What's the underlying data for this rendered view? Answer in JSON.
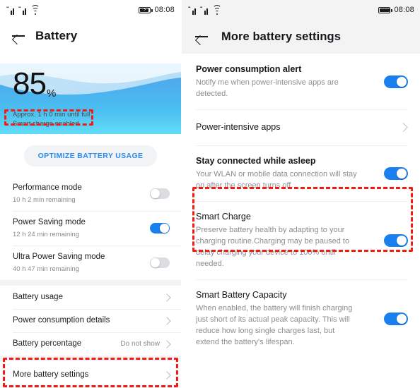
{
  "left_screen": {
    "status_bar": {
      "time": "08:08",
      "signal_icon": "signal-bars-icon",
      "signal_icon_2": "signal-bars-icon",
      "wifi_icon": "wifi-icon",
      "battery_icon": "battery-charging-icon",
      "battery_level_pct": 62
    },
    "app_bar": {
      "back_icon": "back-arrow-icon",
      "title": "Battery"
    },
    "hero": {
      "percent": "85",
      "percent_symbol": "%",
      "time_remaining": "Approx. 1 h 0 min until full",
      "smart_charge_status": "Smart charge enabled"
    },
    "optimize_button": "OPTIMIZE BATTERY USAGE",
    "modes": [
      {
        "title": "Performance mode",
        "subtitle": "10 h 2 min remaining",
        "toggle": "off"
      },
      {
        "title": "Power Saving mode",
        "subtitle": "12 h 24 min remaining",
        "toggle": "on"
      },
      {
        "title": "Ultra Power Saving mode",
        "subtitle": "40 h 47 min remaining",
        "toggle": "off"
      }
    ],
    "links": [
      {
        "title": "Battery usage",
        "value": "",
        "chevron": "chevron-right-icon"
      },
      {
        "title": "Power consumption details",
        "value": "",
        "chevron": "chevron-right-icon"
      },
      {
        "title": "Battery percentage",
        "value": "Do not show",
        "chevron": "chevron-right-icon"
      }
    ],
    "more_settings": {
      "title": "More battery settings",
      "chevron": "chevron-right-icon"
    }
  },
  "right_screen": {
    "status_bar": {
      "time": "08:08",
      "signal_icon": "signal-bars-icon",
      "signal_icon_2": "signal-bars-icon",
      "wifi_icon": "wifi-icon",
      "battery_icon": "battery-full-icon",
      "battery_level_pct": 88
    },
    "app_bar": {
      "back_icon": "back-arrow-icon",
      "title": "More battery settings"
    },
    "items": [
      {
        "title": "Power consumption alert",
        "subtitle": "Notify me when power-intensive apps are detected.",
        "control": "toggle",
        "toggle": "on"
      },
      {
        "title": "Power-intensive apps",
        "subtitle": "",
        "control": "chevron",
        "chevron": "chevron-right-icon"
      },
      {
        "title": "Stay connected while asleep",
        "subtitle": "Your WLAN or mobile data connection will stay on after the screen turns off.",
        "control": "toggle",
        "toggle": "on"
      },
      {
        "title": "Smart Charge",
        "subtitle": "Preserve battery health by adapting to your charging routine.Charging may be paused to delay charging your device to 100% until needed.",
        "control": "toggle",
        "toggle": "on"
      },
      {
        "title": "Smart Battery Capacity",
        "subtitle": "When enabled, the battery will finish charging just short of its actual peak capacity. This will reduce how long single charges last, but extend the battery's lifespan.",
        "control": "toggle",
        "toggle": "on"
      }
    ]
  },
  "annotations": {
    "color": "#f51b12",
    "boxes": [
      {
        "name": "smart-charge-enabled-highlight",
        "screen": "left"
      },
      {
        "name": "more-battery-settings-highlight",
        "screen": "left"
      },
      {
        "name": "smart-charge-row-highlight",
        "screen": "right"
      }
    ]
  },
  "theme": {
    "accent_blue": "#1a80f0",
    "link_blue": "#2b8cf0",
    "text_primary": "#1d1d1f",
    "text_secondary": "#8e8e93",
    "annotation_red": "#f51b12",
    "hero_blue": "#45c3f2",
    "appbar_bg_right": "#f3f3f3"
  }
}
